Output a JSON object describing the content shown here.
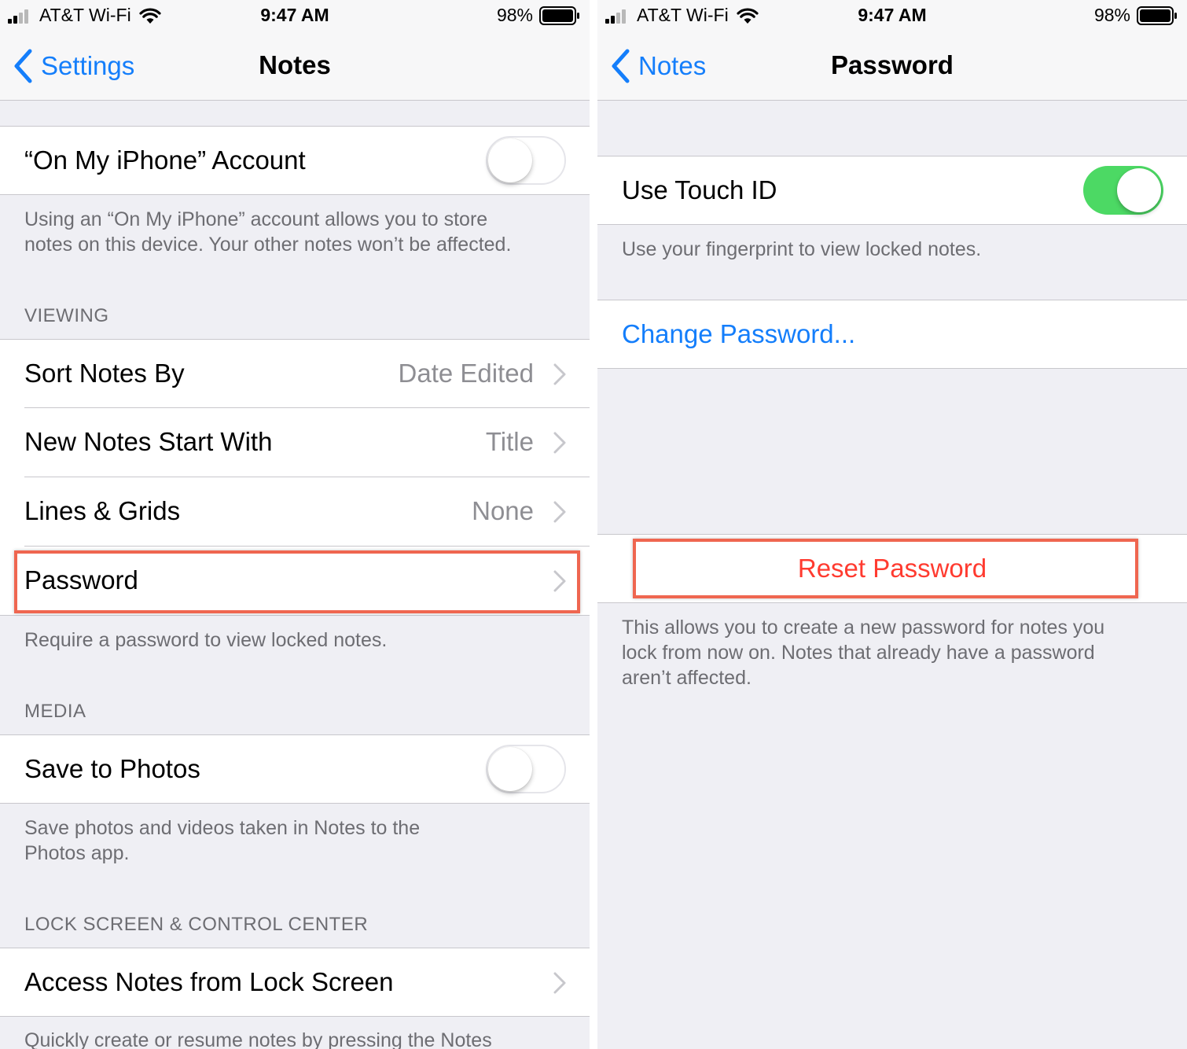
{
  "left": {
    "status": {
      "carrier": "AT&T Wi-Fi",
      "time": "9:47 AM",
      "battery": "98%"
    },
    "nav": {
      "back_label": "Settings",
      "title": "Notes"
    },
    "account": {
      "label": "“On My iPhone” Account",
      "enabled": false,
      "footer_line1": "Using an “On My iPhone” account allows you to store",
      "footer_line2": "notes on this device. Your other notes won’t be affected."
    },
    "viewing": {
      "header": "VIEWING",
      "items": [
        {
          "label": "Sort Notes By",
          "value": "Date Edited"
        },
        {
          "label": "New Notes Start With",
          "value": "Title"
        },
        {
          "label": "Lines & Grids",
          "value": "None"
        },
        {
          "label": "Password",
          "value": ""
        }
      ],
      "footer": "Require a password to view locked notes."
    },
    "media": {
      "header": "MEDIA",
      "label": "Save to Photos",
      "enabled": false,
      "footer_line1": "Save photos and videos taken in Notes to the",
      "footer_line2": "Photos app."
    },
    "lock": {
      "header": "LOCK SCREEN & CONTROL CENTER",
      "label": "Access Notes from Lock Screen",
      "footer": "Quickly create or resume notes by pressing the Notes"
    }
  },
  "right": {
    "status": {
      "carrier": "AT&T Wi-Fi",
      "time": "9:47 AM",
      "battery": "98%"
    },
    "nav": {
      "back_label": "Notes",
      "title": "Password"
    },
    "touch_id": {
      "label": "Use Touch ID",
      "enabled": true,
      "footer": "Use your fingerprint to view locked notes."
    },
    "change_password": "Change Password...",
    "reset": {
      "label": "Reset Password",
      "footer_line1": "This allows you to create a new password for notes you",
      "footer_line2": "lock from now on. Notes that already have a password",
      "footer_line3": "aren’t affected."
    }
  },
  "colors": {
    "accent": "#147efb",
    "switch_on": "#4cd964",
    "destructive": "#ff3b30",
    "highlight": "#ef6650",
    "grouped_background": "#efeff4"
  }
}
